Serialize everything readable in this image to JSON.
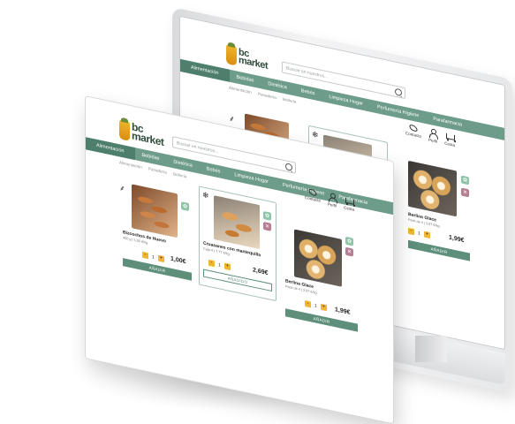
{
  "logo": {
    "line1": "bc",
    "line2": "market"
  },
  "search": {
    "placeholder": "Buscar en nuestros..."
  },
  "nav": [
    "Alimentación",
    "Bebidas",
    "Dietética",
    "Bebés",
    "Limpieza Hogar",
    "Perfumería Higiene",
    "Parafarmacia"
  ],
  "breadcrumb": [
    "Alimentación",
    "Panadería",
    "Bollería"
  ],
  "header_actions": [
    {
      "label": "Contacto",
      "icon": "phone-icon"
    },
    {
      "label": "Perfil",
      "icon": "user-icon"
    },
    {
      "label": "Cesta",
      "icon": "cart-icon"
    }
  ],
  "products": [
    {
      "name": "Bizcochos de Huevo",
      "sub": "400 g | 5,00 €/kg",
      "qty": "1",
      "price": "1,00€",
      "button": "AÑADIR",
      "image": "sausage-pastry",
      "left_icon": "wheat-icon",
      "badges": [
        "bio-icon"
      ]
    },
    {
      "name": "Cruasanes con mantequilla",
      "sub": "Caja 4 | 7,77 €/kg",
      "qty": "1",
      "price": "2,69€",
      "button": "AÑADIDO",
      "image": "croissants",
      "left_icon": "snowflake-icon",
      "badges": [
        "bio-icon",
        "gluten-icon"
      ]
    },
    {
      "name": "Berlina Glace",
      "sub": "Pack de 4 | 3,97 €/kg",
      "qty": "1",
      "price": "1,99€",
      "button": "AÑADIR",
      "image": "donuts",
      "left_icon": "",
      "badges": [
        "bio-icon",
        "gluten-icon"
      ]
    }
  ],
  "colors": {
    "nav": "#6e9c8a",
    "nav_active": "#4d7f6c",
    "button": "#5d8f7b",
    "qty": "#f0b533",
    "badge_bio": "#8fc4a9",
    "badge_gluten": "#b57e93"
  }
}
